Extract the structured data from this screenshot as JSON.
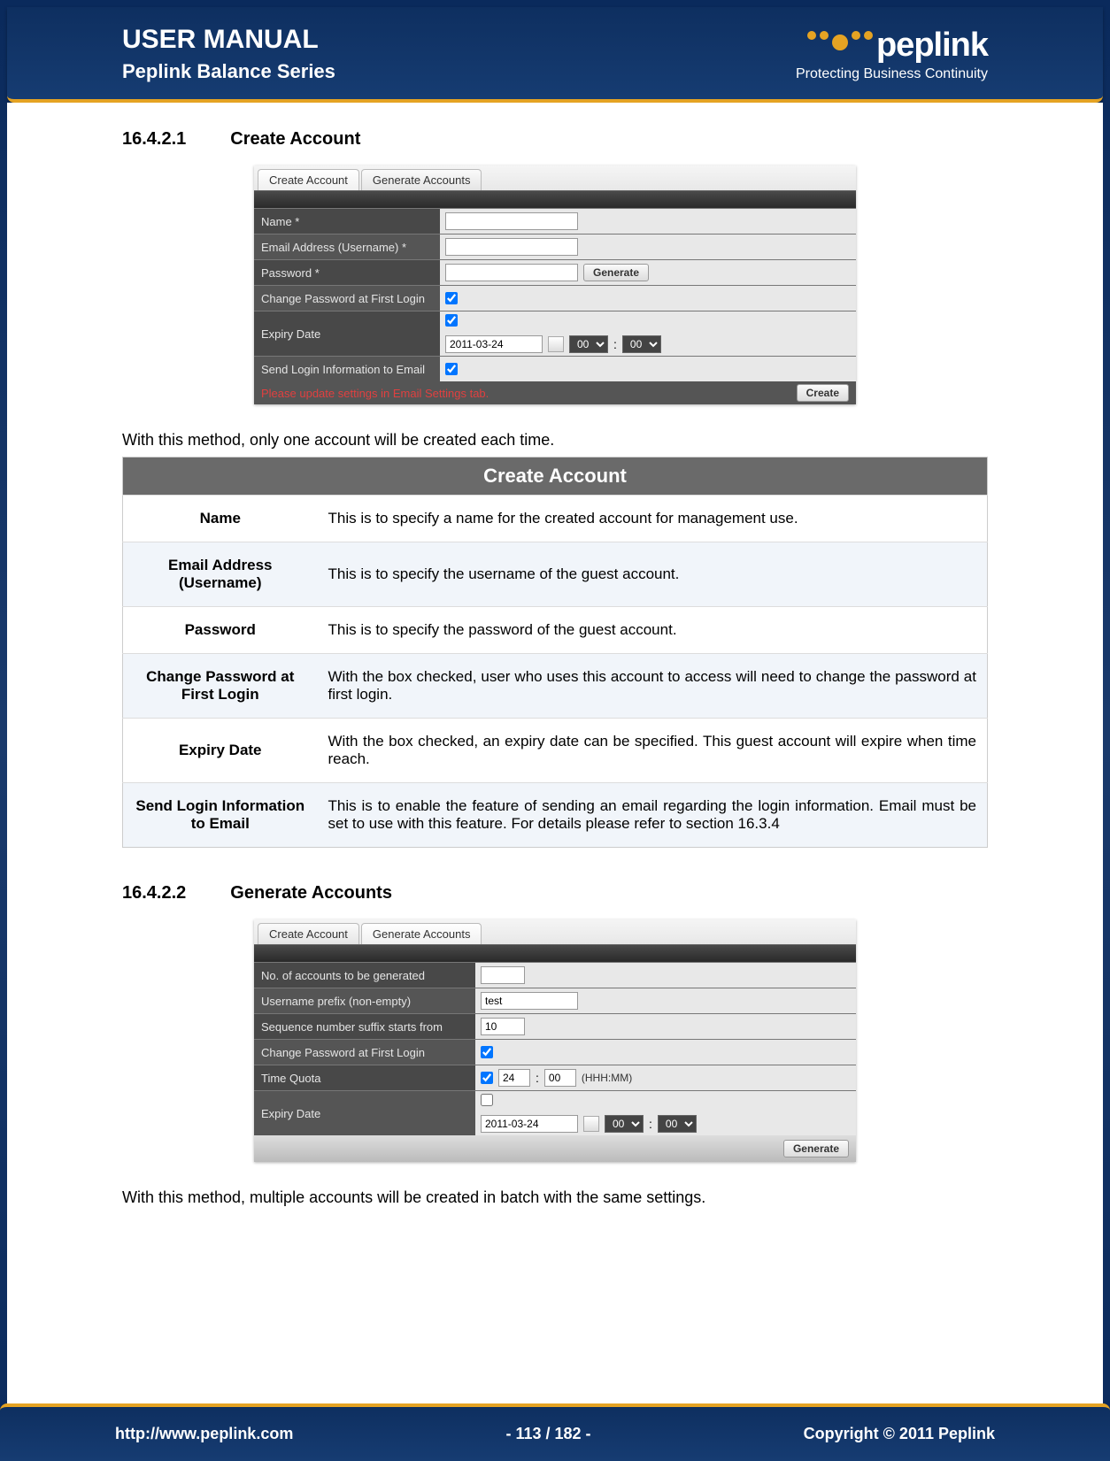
{
  "header": {
    "title": "USER MANUAL",
    "subtitle": "Peplink Balance Series",
    "brand": "peplink",
    "tagline": "Protecting Business Continuity"
  },
  "section1": {
    "number": "16.4.2.1",
    "title": "Create Account",
    "intro": "With this method, only one account will be created each time."
  },
  "ui1": {
    "tab_create": "Create Account",
    "tab_generate": "Generate Accounts",
    "rows": {
      "name": "Name *",
      "email": "Email Address (Username) *",
      "password": "Password *",
      "generate_btn": "Generate",
      "change_pw": "Change Password at First Login",
      "expiry": "Expiry Date",
      "date_value": "2011-03-24",
      "hour": "00",
      "min": "00",
      "send_login": "Send Login Information to Email"
    },
    "warn": "Please update settings in Email Settings tab.",
    "create_btn": "Create"
  },
  "desc_table": {
    "title": "Create Account",
    "rows": [
      {
        "label": "Name",
        "desc": "This is to specify a name for the created account for management use."
      },
      {
        "label": "Email Address (Username)",
        "desc": "This is to specify the username of the guest account."
      },
      {
        "label": "Password",
        "desc": "This is to specify the password of the guest account."
      },
      {
        "label": "Change Password at First Login",
        "desc": "With the box checked, user who uses this account to access will need to change the password at first login."
      },
      {
        "label": "Expiry Date",
        "desc": "With the box checked, an expiry date can be specified. This guest account will expire when time reach."
      },
      {
        "label": "Send Login Information to Email",
        "desc": "This is to enable the feature of sending an email regarding the login information. Email must be set to use with this feature. For details please refer to section 16.3.4"
      }
    ]
  },
  "section2": {
    "number": "16.4.2.2",
    "title": "Generate Accounts",
    "intro": "With this method, multiple accounts will be created in batch with the same settings."
  },
  "ui2": {
    "tab_create": "Create Account",
    "tab_generate": "Generate Accounts",
    "rows": {
      "num_accounts": "No. of accounts to be generated",
      "username_prefix": "Username prefix (non-empty)",
      "username_prefix_val": "test",
      "seq_start": "Sequence number suffix starts from",
      "seq_start_val": "10",
      "change_pw": "Change Password at First Login",
      "time_quota": "Time Quota",
      "tq_h": "24",
      "tq_m": "00",
      "tq_suffix": "(HHH:MM)",
      "expiry": "Expiry Date",
      "date_value": "2011-03-24",
      "hour": "00",
      "min": "00"
    },
    "generate_btn": "Generate"
  },
  "footer": {
    "url": "http://www.peplink.com",
    "page": "- 113 / 182 -",
    "copyright": "Copyright © 2011 Peplink"
  }
}
